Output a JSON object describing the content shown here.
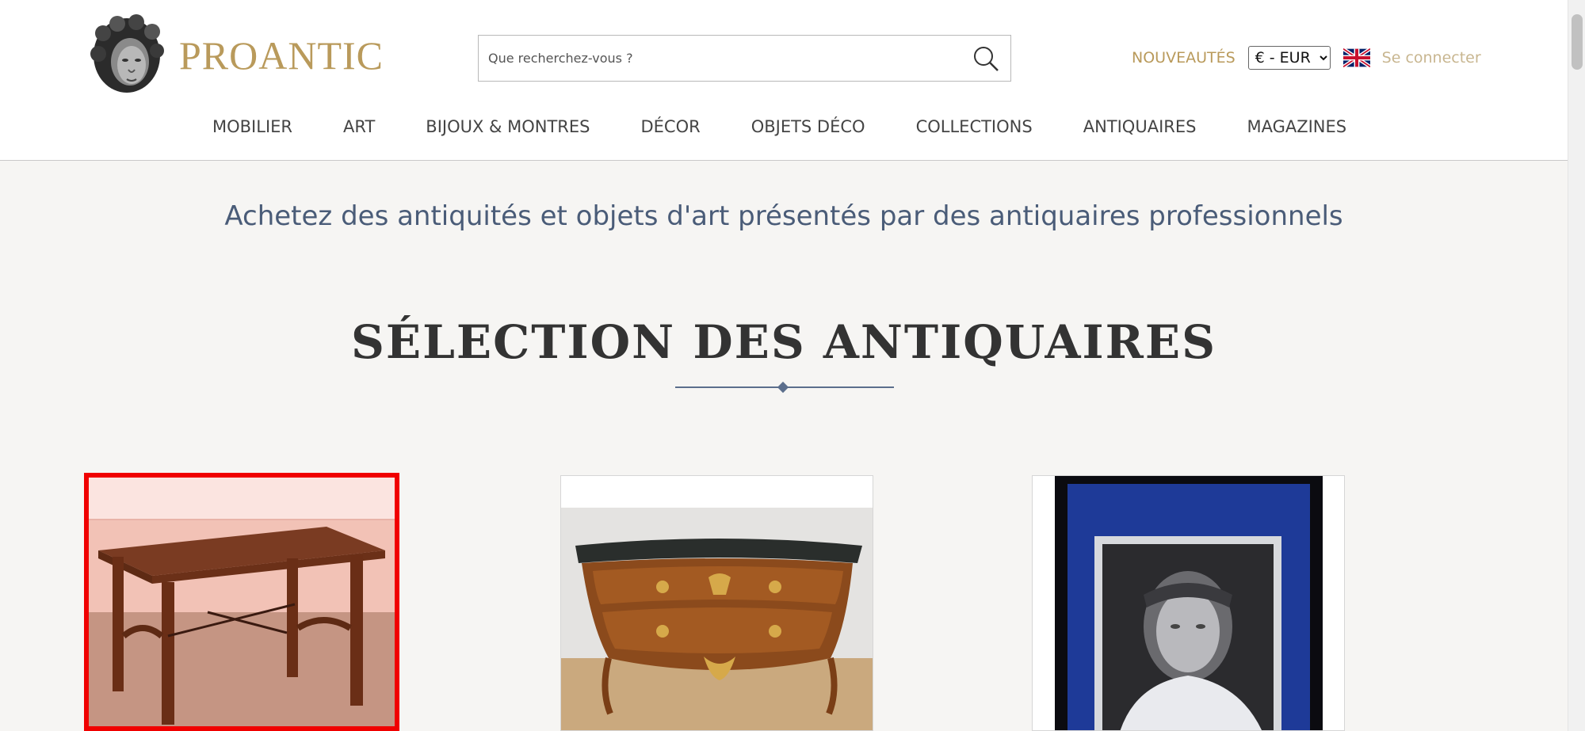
{
  "brand": {
    "name": "PROANTIC"
  },
  "search": {
    "placeholder": "Que recherchez-vous ?"
  },
  "top_links": {
    "new_items": "NOUVEAUTÉS",
    "currency_selected": "€ - EUR",
    "login": "Se connecter"
  },
  "nav": {
    "items": [
      {
        "label": "MOBILIER"
      },
      {
        "label": "ART"
      },
      {
        "label": "BIJOUX & MONTRES"
      },
      {
        "label": "DÉCOR"
      },
      {
        "label": "OBJETS DÉCO"
      },
      {
        "label": "COLLECTIONS"
      },
      {
        "label": "ANTIQUAIRES"
      },
      {
        "label": "MAGAZINES"
      }
    ]
  },
  "main": {
    "tagline": "Achetez des antiquités et objets d'art présentés par des antiquaires professionnels",
    "section_title": "SÉLECTION DES ANTIQUAIRES"
  },
  "icons": {
    "search": "search-icon",
    "flag": "uk-flag-icon",
    "logo": "sculpted-head-logo"
  },
  "colors": {
    "gold": "#b99a5b",
    "navy": "#4a5c78",
    "highlight": "#f00000"
  }
}
